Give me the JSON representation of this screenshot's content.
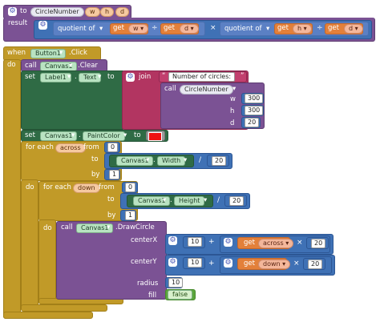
{
  "proc": {
    "keyword": "to",
    "name": "CircleNumber",
    "params": [
      "w",
      "h",
      "d"
    ],
    "result_label": "result",
    "quotient_label": "quotient of",
    "get_label": "get",
    "get_w": "w",
    "get_d": "d",
    "get_h": "h",
    "divide_symbol": "÷",
    "times_symbol": "×"
  },
  "event": {
    "when_label": "when",
    "component": "Button1",
    "event_name": ".Click",
    "do_label": "do"
  },
  "clear_call": {
    "call_label": "call",
    "component": "Canvas1",
    "method": ".Clear"
  },
  "set_label": {
    "set": "set",
    "component": "Label1",
    "dot": ".",
    "property": "Text",
    "to": "to",
    "join": "join",
    "string": "Number of circles: ",
    "call_label": "call",
    "proc_name": "CircleNumber",
    "arg_w": "w",
    "arg_h": "h",
    "arg_d": "d",
    "val_w": "300",
    "val_h": "300",
    "val_d": "20"
  },
  "set_paint": {
    "set": "set",
    "component": "Canvas1",
    "dot": ".",
    "property": "PaintColor",
    "to": "to",
    "color": "#ee1111"
  },
  "outer_loop": {
    "for_each": "for each",
    "var": "across",
    "from": "from",
    "from_val": "0",
    "to": "to",
    "component": "Canvas1",
    "dot": ".",
    "property": "Width",
    "divide": "/",
    "divisor": "20",
    "by": "by",
    "by_val": "1",
    "do_label": "do"
  },
  "inner_loop": {
    "for_each": "for each",
    "var": "down",
    "from": "from",
    "from_val": "0",
    "to": "to",
    "component": "Canvas1",
    "dot": ".",
    "property": "Height",
    "divide": "/",
    "divisor": "20",
    "by": "by",
    "by_val": "1",
    "do_label": "do"
  },
  "draw": {
    "call_label": "call",
    "component": "Canvas1",
    "method": ".DrawCircle",
    "centerX": "centerX",
    "centerY": "centerY",
    "radius": "radius",
    "fill": "fill",
    "offset_x": "10",
    "plus": "+",
    "get_label": "get",
    "var_x": "across",
    "times": "×",
    "mult_x": "20",
    "offset_y": "10",
    "var_y": "down",
    "mult_y": "20",
    "radius_val": "10",
    "fill_val": "false"
  }
}
